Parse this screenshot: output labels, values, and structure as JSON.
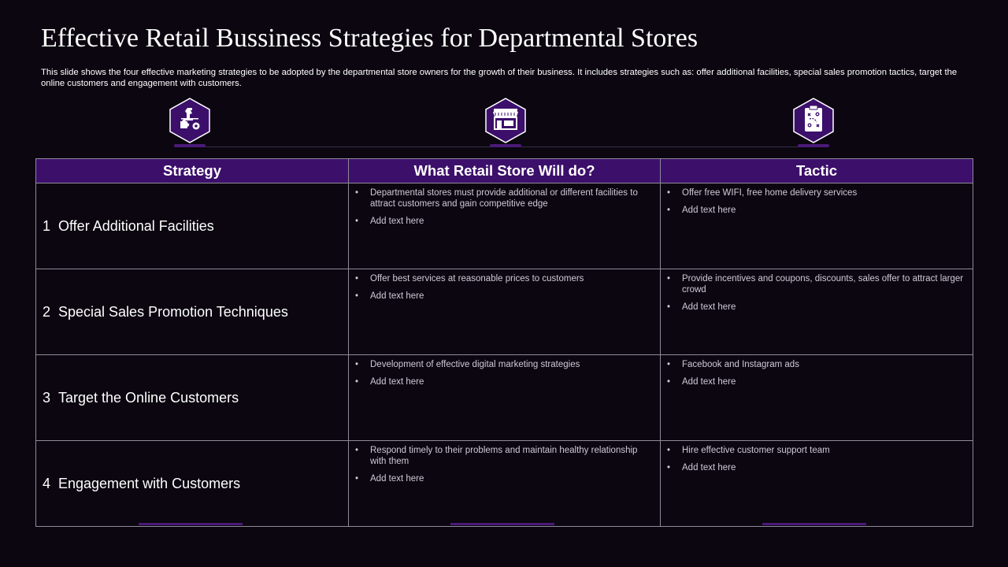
{
  "header": {
    "title": "Effective Retail Bussiness Strategies for Departmental Stores",
    "description": "This slide shows the four effective  marketing strategies to be adopted by the departmental store owners for the growth of their business. It includes strategies such as: offer additional facilities, special sales promotion tactics, target the online customers and engagement with customers."
  },
  "icons": [
    "chess-strategy-icon",
    "storefront-icon",
    "tactics-clipboard-icon"
  ],
  "colors": {
    "background": "#0b0610",
    "accent": "#3c0f6b",
    "border": "#8f8a98"
  },
  "table": {
    "headers": [
      "Strategy",
      "What Retail Store Will do?",
      "Tactic"
    ],
    "rows": [
      {
        "num": "1",
        "strategy": "Offer Additional Facilities",
        "will_do": [
          "Departmental stores must provide additional or different facilities to attract customers and gain competitive edge",
          "Add text here"
        ],
        "tactic": [
          "Offer free WIFI, free home delivery services",
          "Add text here"
        ]
      },
      {
        "num": "2",
        "strategy": "Special Sales Promotion Techniques",
        "will_do": [
          "Offer best services at reasonable prices to customers",
          "Add text here"
        ],
        "tactic": [
          "Provide incentives and coupons, discounts, sales offer to attract larger crowd",
          "Add text here"
        ]
      },
      {
        "num": "3",
        "strategy": "Target the Online Customers",
        "will_do": [
          "Development of effective digital marketing strategies",
          "Add text here"
        ],
        "tactic": [
          "Facebook and Instagram ads",
          "Add text here"
        ]
      },
      {
        "num": "4",
        "strategy": "Engagement with Customers",
        "will_do": [
          "Respond timely to their problems and maintain healthy relationship with them",
          "Add text here"
        ],
        "tactic": [
          "Hire effective customer support team",
          " Add text here"
        ]
      }
    ]
  }
}
